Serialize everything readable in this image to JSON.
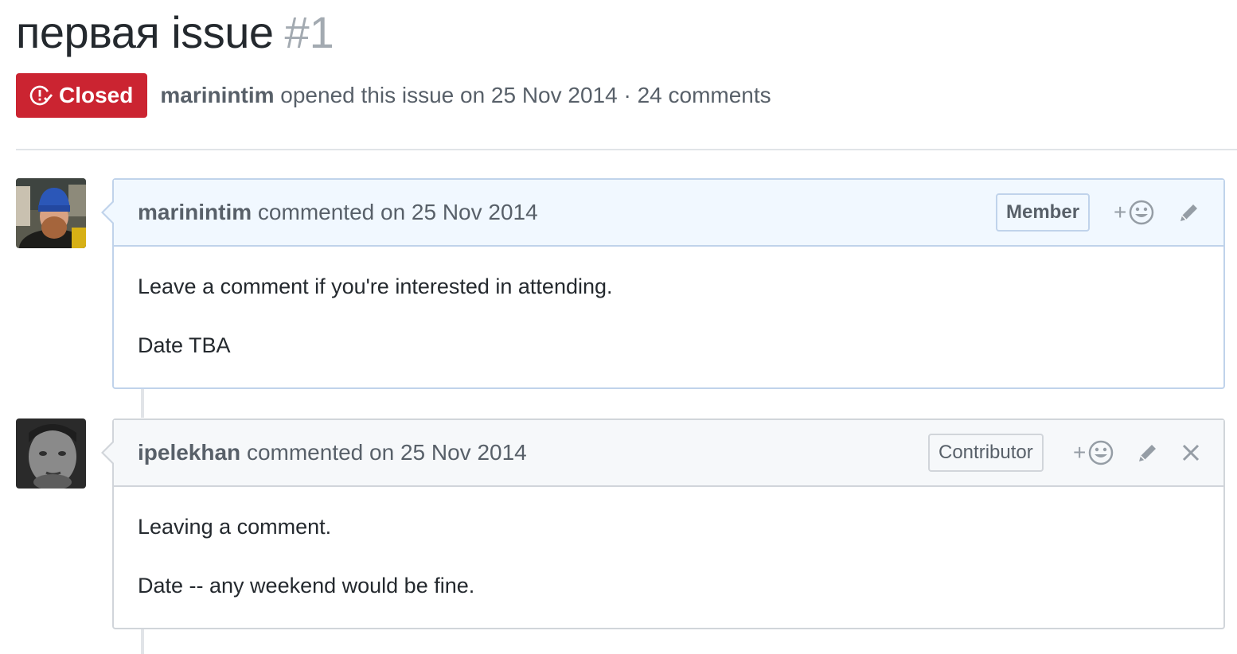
{
  "issue": {
    "title": "первая issue",
    "number": "#1",
    "state": "Closed",
    "author": "marinintim",
    "opened_text": "opened this issue on 25 Nov 2014 · 24 comments"
  },
  "colors": {
    "closed_badge": "#cb2431",
    "member_header": "#f1f8ff",
    "contributor_header": "#f6f8fa",
    "border": "#d1d5da"
  },
  "comments": [
    {
      "author": "marinintim",
      "action_text": "commented on 25 Nov 2014",
      "role": "Member",
      "body": [
        "Leave a comment if you're interested in attending.",
        "Date TBA"
      ],
      "icons": [
        "add-reaction-icon",
        "edit-pencil-icon"
      ]
    },
    {
      "author": "ipelekhan",
      "action_text": "commented on 25 Nov 2014",
      "role": "Contributor",
      "body": [
        "Leaving a comment.",
        "Date -- any weekend would be fine."
      ],
      "icons": [
        "add-reaction-icon",
        "edit-pencil-icon",
        "delete-x-icon"
      ]
    }
  ]
}
